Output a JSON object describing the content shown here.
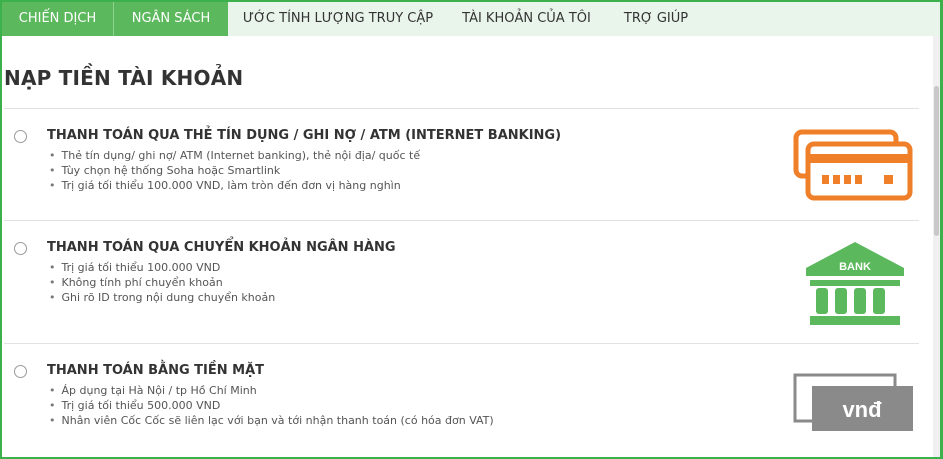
{
  "nav": {
    "tabs": [
      {
        "label": "CHIẾN DỊCH"
      },
      {
        "label": "NGÂN SÁCH"
      },
      {
        "label": "ƯỚC TÍNH LƯỢNG TRUY CẬP"
      },
      {
        "label": "TÀI KHOẢN CỦA TÔI"
      },
      {
        "label": "TRỢ GIÚP"
      }
    ],
    "active_color": "#5cb85c",
    "bar_color": "#e9f4ea"
  },
  "page": {
    "title": "NẠP TIỀN TÀI KHOẢN"
  },
  "options": [
    {
      "title": "THANH TOÁN QUA THẺ TÍN DỤNG / GHI NỢ / ATM (INTERNET BANKING)",
      "bullets": [
        "Thẻ tín dụng/ ghi nợ/ ATM (Internet banking), thẻ nội địa/ quốc tế",
        "Tùy chọn hệ thống Soha hoặc Smartlink",
        "Trị giá tối thiểu 100.000 VND, làm tròn đến đơn vị hàng nghìn"
      ],
      "icon": "credit-card-icon",
      "icon_color": "#f07f2a"
    },
    {
      "title": "THANH TOÁN QUA CHUYỂN KHOẢN NGÂN HÀNG",
      "bullets": [
        "Trị giá tối thiểu 100.000 VND",
        "Không tính phí chuyển khoản",
        "Ghi rõ ID trong nội dung chuyển khoản"
      ],
      "icon": "bank-icon",
      "icon_label": "BANK",
      "icon_color": "#5cb85c"
    },
    {
      "title": "THANH TOÁN BẰNG TIỀN MẶT",
      "bullets": [
        "Áp dụng tại Hà Nội / tp Hồ Chí Minh",
        "Trị giá tối thiểu 500.000 VND",
        "Nhân viên Cốc Cốc sẽ liên lạc với bạn và tới nhận thanh toán (có hóa đơn VAT)"
      ],
      "icon": "cash-vnd-icon",
      "icon_label": "vnđ",
      "icon_color": "#8a8a8a"
    }
  ]
}
